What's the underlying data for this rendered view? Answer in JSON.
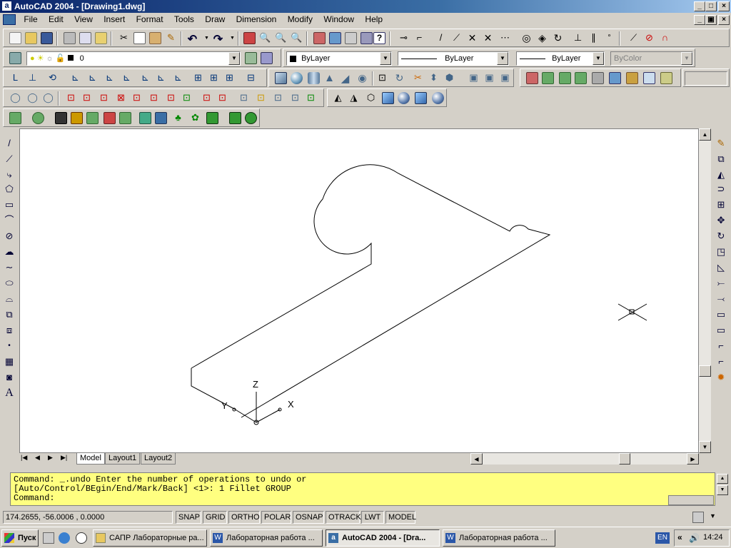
{
  "window": {
    "app_icon": "a",
    "title": "AutoCAD 2004 - [Drawing1.dwg]",
    "controls": [
      "_",
      "□",
      "×"
    ]
  },
  "doc_controls": [
    "_",
    "▣",
    "×"
  ],
  "menu": [
    "File",
    "Edit",
    "View",
    "Insert",
    "Format",
    "Tools",
    "Draw",
    "Dimension",
    "Modify",
    "Window",
    "Help"
  ],
  "layers": {
    "current": "0",
    "color": "ByLayer",
    "linetype": "ByLayer",
    "lineweight": "ByLayer",
    "plotstyle": "ByColor"
  },
  "ucs": {
    "x": "X",
    "y": "Y",
    "z": "Z"
  },
  "tabs": [
    {
      "label": "Model",
      "active": true
    },
    {
      "label": "Layout1"
    },
    {
      "label": "Layout2"
    }
  ],
  "command": {
    "line1": "Command: _.undo Enter the number of operations to undo or",
    "line2": "[Auto/Control/BEgin/End/Mark/Back] <1>: 1 Fillet GROUP",
    "prompt": "Command:"
  },
  "status": {
    "coords": "174.2655, -56.0006 , 0.0000",
    "toggles": [
      "SNAP",
      "GRID",
      "ORTHO",
      "POLAR",
      "OSNAP",
      "OTRACK",
      "LWT",
      "MODEL"
    ]
  },
  "taskbar": {
    "start": "Пуск",
    "tasks": [
      "САПР Лабораторные ра...",
      "Лабораторная работа ...",
      "AutoCAD 2004 - [Dra...",
      "Лабораторная работа ..."
    ],
    "lang": "EN",
    "clock": "14:24"
  },
  "colors": {
    "titlebar": "#0a246a",
    "command_bg": "#ffff80",
    "canvas": "#ffffff"
  }
}
